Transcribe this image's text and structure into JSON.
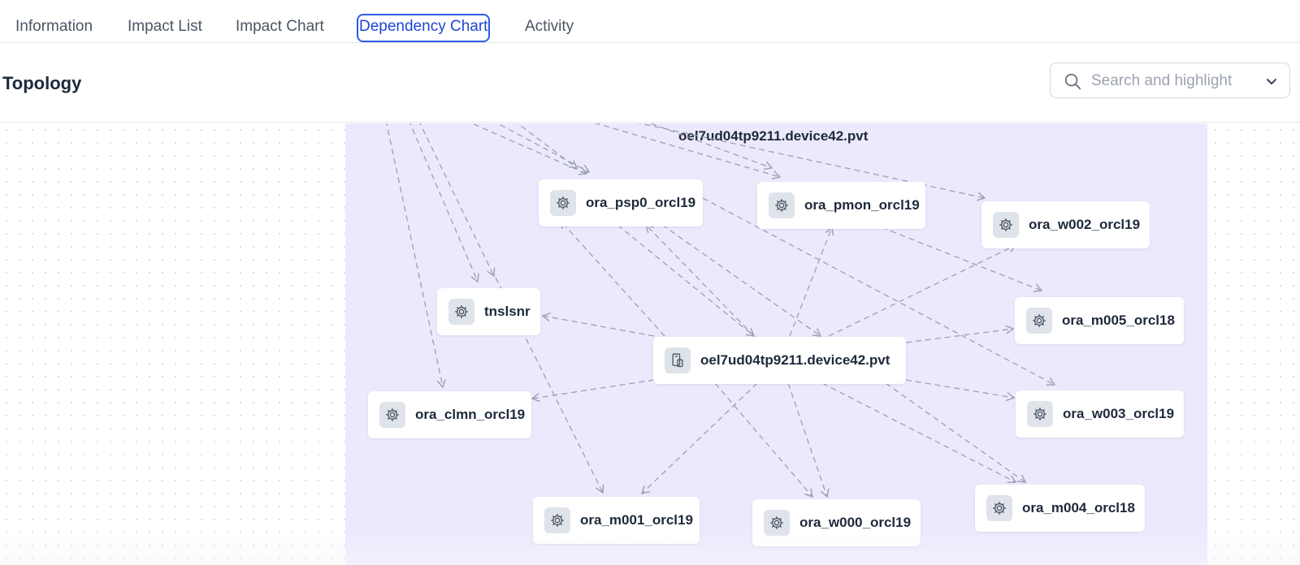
{
  "tabs": [
    {
      "label": "Information"
    },
    {
      "label": "Impact List"
    },
    {
      "label": "Impact Chart"
    },
    {
      "label": "Dependency Chart",
      "active": true
    },
    {
      "label": "Activity"
    }
  ],
  "header": {
    "title": "Topology",
    "search": {
      "placeholder": "Search and highlight",
      "icon": "search-icon",
      "dropdown_icon": "chevron-down-icon"
    }
  },
  "topology": {
    "group_label": "oel7ud04tp9211.device42.pvt",
    "nodes": [
      {
        "id": "psp0",
        "label": "ora_psp0_orcl19",
        "icon": "service-gear-icon"
      },
      {
        "id": "pmon",
        "label": "ora_pmon_orcl19",
        "icon": "service-gear-icon"
      },
      {
        "id": "w002",
        "label": "ora_w002_orcl19",
        "icon": "service-gear-icon"
      },
      {
        "id": "tnslsnr",
        "label": "tnslsnr",
        "icon": "service-gear-icon"
      },
      {
        "id": "m005",
        "label": "ora_m005_orcl18",
        "icon": "service-gear-icon"
      },
      {
        "id": "device",
        "label": "oel7ud04tp9211.device42.pvt",
        "icon": "device-icon"
      },
      {
        "id": "clmn",
        "label": "ora_clmn_orcl19",
        "icon": "service-gear-icon"
      },
      {
        "id": "w003",
        "label": "ora_w003_orcl19",
        "icon": "service-gear-icon"
      },
      {
        "id": "m001",
        "label": "ora_m001_orcl19",
        "icon": "service-gear-icon"
      },
      {
        "id": "w000",
        "label": "ora_w000_orcl19",
        "icon": "service-gear-icon"
      },
      {
        "id": "m004",
        "label": "ora_m004_orcl18",
        "icon": "service-gear-icon"
      }
    ]
  },
  "colors": {
    "accent": "#2c5be6",
    "group_bg": "#ece9fd",
    "edge": "#9aa0b4"
  }
}
